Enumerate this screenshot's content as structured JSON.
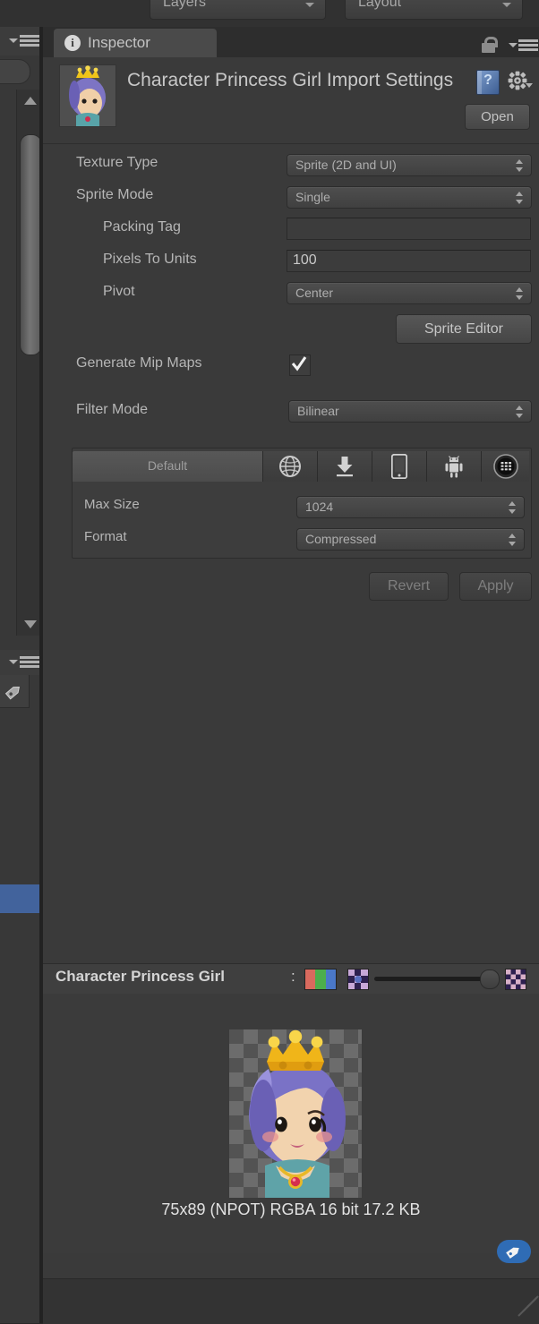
{
  "toolbar": {
    "layers_label": "Layers",
    "layout_label": "Layout"
  },
  "inspector": {
    "tab_label": "Inspector",
    "info_badge": "i",
    "lock_icon": "unlocked-padlock-icon",
    "menu_icon": "hamburger-menu-icon"
  },
  "object_header": {
    "title": "Character Princess Girl Import Settings",
    "open_label": "Open",
    "help_icon": "help-book-icon",
    "help_glyph": "?",
    "gear_icon": "gear-icon",
    "thumbnail": "princess-sprite-thumbnail"
  },
  "properties": [
    {
      "label": "Texture Type",
      "value": "Sprite (2D and UI)",
      "type": "popup"
    },
    {
      "label": "Sprite Mode",
      "value": "Single",
      "type": "popup"
    },
    {
      "label": "Packing Tag",
      "value": "",
      "type": "text"
    },
    {
      "label": "Pixels To Units",
      "value": "100",
      "type": "text"
    },
    {
      "label": "Pivot",
      "value": "Center",
      "type": "popup"
    }
  ],
  "sprite_editor": {
    "label": "Sprite Editor"
  },
  "mip_maps": {
    "label": "Generate Mip Maps",
    "checked": true
  },
  "filter_mode": {
    "label": "Filter Mode",
    "value": "Bilinear"
  },
  "platform_tabs": [
    {
      "name": "Default",
      "label": "Default",
      "icon": "default-tab",
      "selected": true
    },
    {
      "name": "Web",
      "label": "",
      "icon": "globe-icon",
      "selected": false
    },
    {
      "name": "Standalone",
      "label": "",
      "icon": "download-icon",
      "selected": false
    },
    {
      "name": "iOS",
      "label": "",
      "icon": "phone-icon",
      "selected": false
    },
    {
      "name": "Android",
      "label": "",
      "icon": "android-icon",
      "selected": false
    },
    {
      "name": "BlackBerry",
      "label": "",
      "icon": "blackberry-icon",
      "selected": false
    }
  ],
  "platform_settings": [
    {
      "label": "Max Size",
      "value": "1024"
    },
    {
      "label": "Format",
      "value": "Compressed"
    }
  ],
  "footer": {
    "revert_label": "Revert",
    "apply_label": "Apply",
    "revert_enabled": false,
    "apply_enabled": false
  },
  "preview": {
    "title": "Character Princess Girl",
    "separator": ":",
    "rgb_channels": [
      "#d96a5e",
      "#4cae4c",
      "#4a78c8"
    ],
    "mip_small_icon": "texture-small-icon",
    "mip_large_icon": "texture-large-icon",
    "info": "75x89 (NPOT)  RGBA 16 bit  17.2 KB",
    "dimensions": "75x89",
    "npot": "(NPOT)",
    "format": "RGBA 16 bit",
    "size": "17.2 KB",
    "tag_badge_icon": "tag-icon"
  },
  "sidebar": {
    "menu_icon_top": "hamburger-menu-icon",
    "menu_icon_mid": "hamburger-menu-icon",
    "tag_tab_icon": "tag-icon",
    "scrollbar": {
      "up_arrow": "triangle-up-icon",
      "down_arrow": "triangle-down-icon"
    }
  },
  "colors": {
    "panel_bg": "#3a3a3a",
    "toolbar_bg": "#313131",
    "tab_selected": "#4a4a4a",
    "selection_blue": "#42639c",
    "badge_blue": "#2f6cb5",
    "text": "#b6b6b6"
  }
}
